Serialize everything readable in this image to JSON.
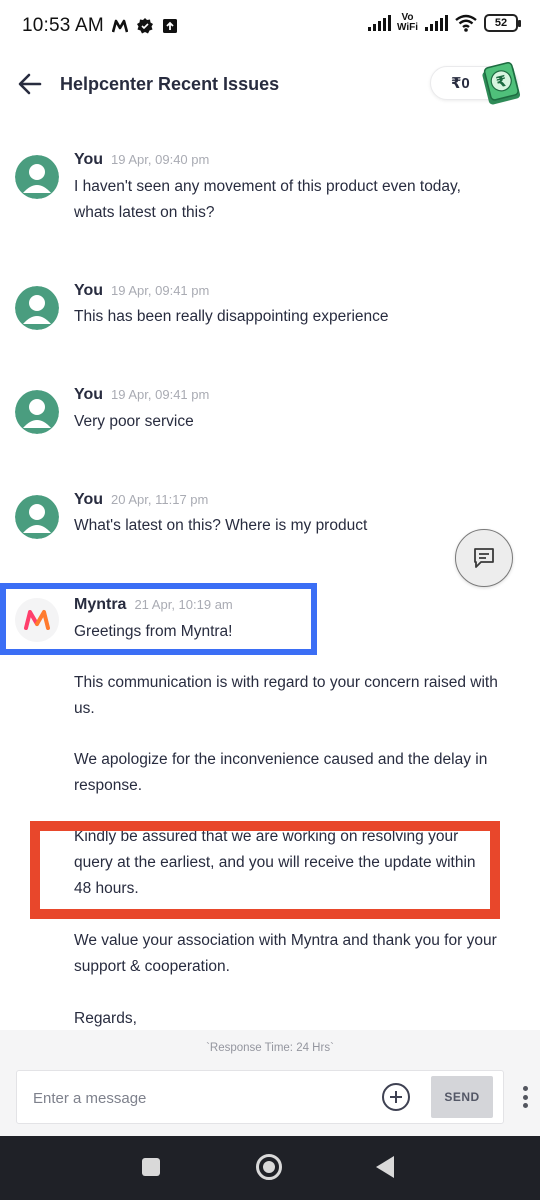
{
  "status_bar": {
    "time": "10:53 AM",
    "left_icons": [
      "myntra-m-icon",
      "badge-icon",
      "upload-icon"
    ],
    "network_label_top": "Vo",
    "network_label_bottom": "WiFi",
    "battery": "52"
  },
  "header": {
    "title": "Helpcenter Recent Issues",
    "wallet_amount": "₹0"
  },
  "messages": [
    {
      "sender": "You",
      "time": "19 Apr, 09:40 pm",
      "text": "I haven't seen any movement of this product even today, whats latest on this?"
    },
    {
      "sender": "You",
      "time": "19 Apr, 09:41 pm",
      "text": "This has been really disappointing experience"
    },
    {
      "sender": "You",
      "time": "19 Apr, 09:41 pm",
      "text": "Very poor service"
    },
    {
      "sender": "You",
      "time": "20 Apr, 11:17 pm",
      "text": "What's latest on this? Where is my product"
    }
  ],
  "reply": {
    "sender": "Myntra",
    "time": "21 Apr, 10:19 am",
    "greeting": "Greetings from Myntra!",
    "paragraphs": [
      "This communication is with regard to your concern raised with us.",
      "We apologize for the inconvenience caused and the delay in response.",
      "Kindly be assured that we are working on resolving your query at the earliest, and you will receive the update within 48 hours.",
      "We value your association with Myntra and thank you for your support & cooperation.",
      "Regards,"
    ]
  },
  "composer": {
    "response_time": "`Response Time: 24 Hrs`",
    "placeholder": "Enter a message",
    "send_label": "SEND"
  },
  "colors": {
    "avatar_user": "#4a9d7f",
    "highlight_blue": "#3b6ef5",
    "highlight_red": "#e8472b",
    "myntra_pink": "#ff3f6c"
  }
}
